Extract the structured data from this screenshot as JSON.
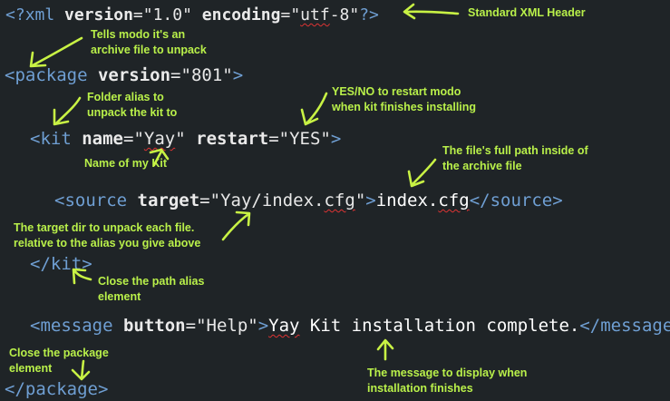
{
  "code": {
    "line1": {
      "open": "<?",
      "tag": "xml",
      "attr1": "version",
      "eq1": "=",
      "val1": "\"1.0\"",
      "attr2": "encoding",
      "eq2": "=",
      "val2a": "\"",
      "val2b": "utf",
      "val2c": "-8\"",
      "close": "?>"
    },
    "line2": {
      "open": "<package",
      "attr": "version",
      "eq": "=",
      "val": "\"801\"",
      "close": ">"
    },
    "line3": {
      "open": "<kit",
      "attr1": "name",
      "eq1": "=",
      "val1a": "\"",
      "val1b": "Yay",
      "val1c": "\"",
      "attr2": "restart",
      "eq2": "=",
      "val2": "\"YES\"",
      "close": ">"
    },
    "line4": {
      "open": "<source",
      "attr": "target",
      "eq": "=",
      "vala": "\"",
      "valb": "Yay",
      "valc": "/index.",
      "vald": "cfg",
      "vale": "\"",
      "gt": ">",
      "texta": "index.",
      "textb": "cfg",
      "close": "</source>"
    },
    "line5": {
      "close": "</kit>"
    },
    "line6": {
      "open": "<message",
      "attr": "button",
      "eq": "=",
      "val": "\"Help\"",
      "gt": ">",
      "texta": "Yay",
      "textb": " Kit installation complete.",
      "close": "</message>"
    },
    "line7": {
      "close": "</package>"
    }
  },
  "annotations": {
    "standard_header": "Standard XML Header",
    "archive": "Tells modo it's an\narchive file to unpack",
    "folder_alias": "Folder alias to\nunpack the kit to",
    "restart": "YES/NO to restart modo\nwhen kit finishes installing",
    "kit_name": "Name of my Kit",
    "full_path": "The file's full path inside of\nthe archive file",
    "target_dir": "The target dir to unpack each file.\nrelative to the alias you give above",
    "close_alias": "Close the path alias\nelement",
    "close_package": "Close the package\nelement",
    "message": "The message to display when\ninstallation finishes"
  },
  "colors": {
    "background": "#1f2427",
    "tag_blue": "#6f9fd3",
    "annotation_green": "#b9f04a",
    "squiggle_red": "#d33"
  }
}
